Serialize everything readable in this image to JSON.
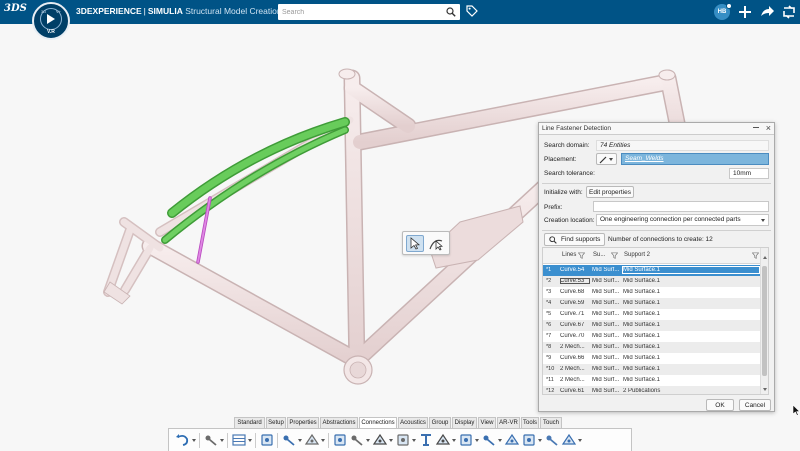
{
  "header": {
    "brand_logo": "3DS",
    "compass_version": "V.R",
    "compass_left": "3D",
    "compass_right": "V+",
    "title_brand_bold": "3DEXPERIENCE",
    "title_separator": "|",
    "title_brand_simulia": "SIMULIA",
    "title_app": "Structural Model Creation",
    "search_placeholder": "Search",
    "avatar_initials": "HB",
    "icons": [
      "search-icon",
      "tag-icon",
      "add-icon",
      "share-icon",
      "collaborate-icon",
      "help-icon"
    ]
  },
  "context_toolbar": {
    "icons": [
      "select-cursor-icon",
      "select-geometry-icon"
    ]
  },
  "dialog": {
    "title": "Line Fastener Detection",
    "search_domain_label": "Search domain:",
    "search_domain_value": "74 Entities",
    "placement_label": "Placement:",
    "placement_value": "Seam_Welds",
    "search_tolerance_label": "Search tolerance:",
    "search_tolerance_value": "10mm",
    "initialize_with_label": "Initialize with:",
    "edit_properties_label": "Edit properties",
    "prefix_label": "Prefix:",
    "prefix_value": "",
    "creation_location_label": "Creation location:",
    "creation_location_value": "One engineering connection per connected parts",
    "find_supports_label": "Find supports",
    "connections_count_text": "Number of connections to create: 12",
    "columns": [
      "Lines",
      "Su...",
      "Support 2"
    ],
    "rows": [
      {
        "idx": "*1",
        "line": "Curve.54",
        "support1": "Mid Surf...",
        "support2": "Mid Surface.1"
      },
      {
        "idx": "*2",
        "line": "Curve.53",
        "support1": "Mid Surf...",
        "support2": "Mid Surface.1"
      },
      {
        "idx": "*3",
        "line": "Curve.68",
        "support1": "Mid Surf...",
        "support2": "Mid Surface.1"
      },
      {
        "idx": "*4",
        "line": "Curve.59",
        "support1": "Mid Surf...",
        "support2": "Mid Surface.1"
      },
      {
        "idx": "*5",
        "line": "Curve.71",
        "support1": "Mid Surf...",
        "support2": "Mid Surface.1"
      },
      {
        "idx": "*6",
        "line": "Curve.67",
        "support1": "Mid Surf...",
        "support2": "Mid Surface.1"
      },
      {
        "idx": "*7",
        "line": "Curve.70",
        "support1": "Mid Surf...",
        "support2": "Mid Surface.1"
      },
      {
        "idx": "*8",
        "line": "2 Mech...",
        "support1": "Mid Surf...",
        "support2": "Mid Surface.1"
      },
      {
        "idx": "*9",
        "line": "Curve.66",
        "support1": "Mid Surf...",
        "support2": "Mid Surface.1"
      },
      {
        "idx": "*10",
        "line": "2 Mech...",
        "support1": "Mid Surf...",
        "support2": "Mid Surface.1"
      },
      {
        "idx": "*11",
        "line": "2 Mech...",
        "support1": "Mid Surf...",
        "support2": "Mid Surface.1"
      },
      {
        "idx": "*12",
        "line": "Curve.61",
        "support1": "Mid Surf...",
        "support2": "2 Publications"
      }
    ],
    "ok_label": "OK",
    "cancel_label": "Cancel"
  },
  "bottom_tabs": [
    "Standard",
    "Setup",
    "Properties",
    "Abstractions",
    "Connections",
    "Acoustics",
    "Group",
    "Display",
    "View",
    "AR-VR",
    "Tools",
    "Touch"
  ],
  "active_tab": "Connections",
  "action_bar_icons": [
    "undo-icon",
    "part-icon",
    "table-icon",
    "node-icon",
    "fastener-icon",
    "point-fastener-icon",
    "line-fastener-icon",
    "pin-icon",
    "connector-icon",
    "spring-icon",
    "beam-icon",
    "joint-icon",
    "detect-fastener-icon",
    "surface-fastener-icon",
    "rigid-icon",
    "tie-icon",
    "clamp-icon",
    "assembly-icon"
  ],
  "colors": {
    "header_bg": "#005386",
    "frame": "#f1e1e1",
    "weld_green": "#5fc452",
    "weld_magenta": "#d36ad6",
    "selection_blue": "#3b8fcf"
  }
}
